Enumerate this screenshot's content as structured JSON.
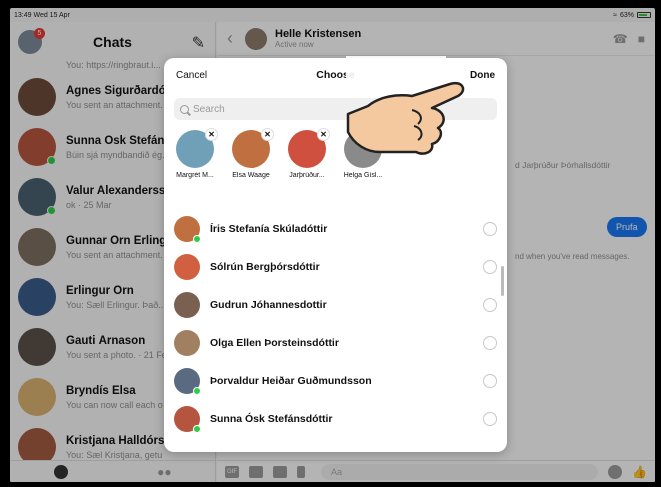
{
  "status_bar": {
    "time": "13:49  Wed 15 Apr",
    "battery": "63%"
  },
  "sidebar": {
    "title": "Chats",
    "badge": "5",
    "top_partial": "You: https://ringbraut.i... · 11 Mar",
    "chats": [
      {
        "name": "Agnes Sigurðardótti",
        "sub": "You sent an attachment.",
        "online": false,
        "color": "#6b4a3a"
      },
      {
        "name": "Sunna Ósk Stefánsd",
        "sub": "Búin sjá myndbandið ég.",
        "online": true,
        "color": "#b5553f"
      },
      {
        "name": "Valur Alexandersson",
        "sub": "ok · 25 Mar",
        "online": true,
        "color": "#4a6070"
      },
      {
        "name": "Gunnar Örn Erlingss",
        "sub": "You sent an attachment.",
        "online": false,
        "color": "#7d6e60"
      },
      {
        "name": "Erlingur Örn",
        "sub": "You: Sæll Erlingur. Það...",
        "online": false,
        "color": "#3a5a8a"
      },
      {
        "name": "Gauti Árnason",
        "sub": "You sent a photo. · 21 Fe",
        "online": false,
        "color": "#5a5048"
      },
      {
        "name": "Bryndís Elsa",
        "sub": "You can now call each o",
        "online": false,
        "color": "#d8b070"
      },
      {
        "name": "Kristjana Halldórsdó",
        "sub": "You: Sæl Kristjana, getu",
        "online": false,
        "color": "#a05a40"
      }
    ]
  },
  "conversation": {
    "name": "Helle Kristensen",
    "status": "Active now",
    "line1": "d Jarþrúður Þórhallsdóttir",
    "bubble": "Prufa",
    "line2": "nd when you've read messages.",
    "input_placeholder": "Aa"
  },
  "modal": {
    "cancel": "Cancel",
    "title": "Choose",
    "done": "Done",
    "search_placeholder": "Search",
    "selected": [
      {
        "label": "Margrét M...",
        "color": "#6fa0b8",
        "removable": true
      },
      {
        "label": "Elsa Waage",
        "color": "#c07040",
        "removable": true
      },
      {
        "label": "Jarþrúður...",
        "color": "#d05040",
        "removable": true
      },
      {
        "label": "Helga Gísl...",
        "color": "#8a8a8a",
        "removable": false
      }
    ],
    "contacts": [
      {
        "name": "Íris Stefanía Skúladóttir",
        "online": true,
        "color": "#c07040"
      },
      {
        "name": "Sólrún Bergþórsdóttir",
        "online": false,
        "color": "#d06040"
      },
      {
        "name": "Gudrun Jóhannesdottir",
        "online": false,
        "color": "#7a6050"
      },
      {
        "name": "Olga Ellen Þorsteinsdóttir",
        "online": false,
        "color": "#a08060"
      },
      {
        "name": "Þorvaldur Heiðar Guðmundsson",
        "online": true,
        "color": "#5a6a80"
      },
      {
        "name": "Sunna Ósk Stefánsdóttir",
        "online": true,
        "color": "#b5553f"
      }
    ]
  }
}
